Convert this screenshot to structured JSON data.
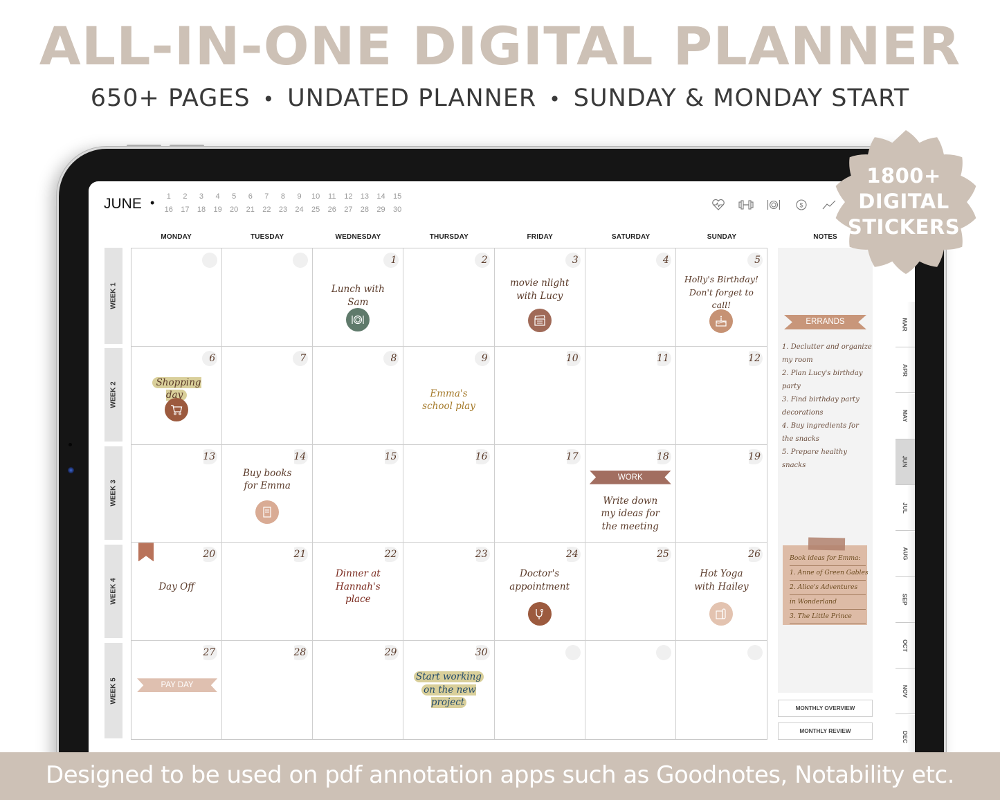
{
  "hero": {
    "title": "ALL-IN-ONE DIGITAL PLANNER",
    "subtitle_parts": [
      "650+ PAGES",
      "UNDATED PLANNER",
      "SUNDAY & MONDAY START"
    ],
    "separator": "•",
    "title_color": "#cdc1b6"
  },
  "badge": {
    "line1": "1800+",
    "line2": "DIGITAL",
    "line3": "STICKERS",
    "color": "#cdc1b6"
  },
  "footer": {
    "text": "Designed to be used on pdf annotation apps such as Goodnotes, Notability etc."
  },
  "planner": {
    "month": "JUNE",
    "month_dot": "•",
    "mini_days": [
      "1",
      "2",
      "3",
      "4",
      "5",
      "6",
      "7",
      "8",
      "9",
      "10",
      "11",
      "12",
      "13",
      "14",
      "15",
      "16",
      "17",
      "18",
      "19",
      "20",
      "21",
      "22",
      "23",
      "24",
      "25",
      "26",
      "27",
      "28",
      "29",
      "30"
    ],
    "tool_icons": [
      "heart-rate-icon",
      "dumbbell-icon",
      "plate-cutlery-icon",
      "dollar-coin-icon",
      "chart-line-icon"
    ],
    "day_headers": [
      "MONDAY",
      "TUESDAY",
      "WEDNESDAY",
      "THURSDAY",
      "FRIDAY",
      "SATURDAY",
      "SUNDAY"
    ],
    "notes_header": "NOTES",
    "weeks": [
      "WEEK 1",
      "WEEK 2",
      "WEEK 3",
      "WEEK 4",
      "WEEK 5"
    ],
    "cells": [
      {
        "date": ""
      },
      {
        "date": ""
      },
      {
        "date": "1",
        "text": "Lunch with Sam",
        "icon": "plate-cutlery-icon",
        "icon_color": "#5f7a6b"
      },
      {
        "date": "2"
      },
      {
        "date": "3",
        "text": "movie nlight with Lucy",
        "icon": "clapperboard-icon",
        "icon_color": "#a06a58"
      },
      {
        "date": "4"
      },
      {
        "date": "5",
        "text": "Holly's Birthday! Don't forget to call!",
        "icon": "birthday-cake-icon",
        "icon_color": "#c69274"
      },
      {
        "date": "6",
        "text": "Shopping day",
        "icon": "shopping-cart-icon",
        "icon_color": "#9c5a3e"
      },
      {
        "date": "7"
      },
      {
        "date": "8"
      },
      {
        "date": "9",
        "text": "Emma's school play"
      },
      {
        "date": "10"
      },
      {
        "date": "11"
      },
      {
        "date": "12"
      },
      {
        "date": "13"
      },
      {
        "date": "14",
        "text": "Buy books for Emma",
        "icon": "book-icon",
        "icon_color": "#d9ab94"
      },
      {
        "date": "15"
      },
      {
        "date": "16"
      },
      {
        "date": "17"
      },
      {
        "date": "18",
        "banner": "WORK",
        "text": "Write down my ideas for the meeting"
      },
      {
        "date": "19"
      },
      {
        "date": "20",
        "text": "Day Off"
      },
      {
        "date": "21"
      },
      {
        "date": "22",
        "text": "Dinner at Hannah's place"
      },
      {
        "date": "23"
      },
      {
        "date": "24",
        "text": "Doctor's appointment",
        "icon": "stethoscope-icon",
        "icon_color": "#9c5a3e"
      },
      {
        "date": "25"
      },
      {
        "date": "26",
        "text": "Hot Yoga with Hailey",
        "icon": "yoga-mat-icon",
        "icon_color": "#e3c3b0"
      },
      {
        "date": "27",
        "banner": "PAY DAY"
      },
      {
        "date": "28"
      },
      {
        "date": "29"
      },
      {
        "date": "30",
        "text_lines": [
          "Start working",
          "on the new project"
        ]
      },
      {
        "date": ""
      },
      {
        "date": ""
      },
      {
        "date": ""
      }
    ],
    "notes": {
      "errands_title": "ERRANDS",
      "errands": [
        "1. Declutter and organize my room",
        "2. Plan Lucy's birthday party",
        "3. Find birthday party decorations",
        "4. Buy ingredients for the snacks",
        "5. Prepare healthy snacks"
      ],
      "sticky_note": [
        "Book ideas for Emma:",
        "1. Anne of Green Gables",
        "2. Alice's Adventures",
        "in Wonderland",
        "3. The Little Prince"
      ]
    },
    "buttons": {
      "monthly_overview": "MONTHLY OVERVIEW",
      "monthly_review": "MONTHLY REVIEW"
    },
    "month_tabs": [
      "MAR",
      "APR",
      "MAY",
      "JUN",
      "JUL",
      "AUG",
      "SEP",
      "OCT",
      "NOV",
      "DEC"
    ],
    "active_tab": "JUN"
  }
}
